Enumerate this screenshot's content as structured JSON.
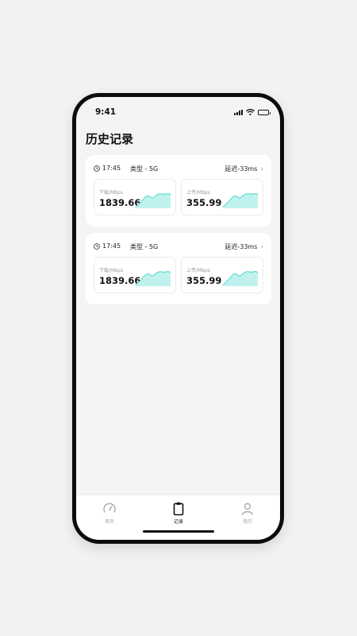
{
  "status_bar": {
    "time": "9:41"
  },
  "page": {
    "title": "历史记录"
  },
  "records": [
    {
      "time": "17:45",
      "type": "类型 - 5G",
      "latency": "延迟-33ms",
      "download": {
        "label": "下载/Mbps",
        "value": "1839.66"
      },
      "upload": {
        "label": "上传/Mbps",
        "value": "355.99"
      }
    },
    {
      "time": "17:45",
      "type": "类型 - 5G",
      "latency": "延迟-33ms",
      "download": {
        "label": "下载/Mbps",
        "value": "1839.66"
      },
      "upload": {
        "label": "上传/Mbps",
        "value": "355.99"
      }
    }
  ],
  "tabs": [
    {
      "label": "首页",
      "icon": "speedometer-icon",
      "active": false
    },
    {
      "label": "记录",
      "icon": "clipboard-icon",
      "active": true
    },
    {
      "label": "我的",
      "icon": "user-icon",
      "active": false
    }
  ],
  "colors": {
    "accent": "#4fd6cf",
    "background": "#f4f4f5",
    "card": "#ffffff"
  }
}
